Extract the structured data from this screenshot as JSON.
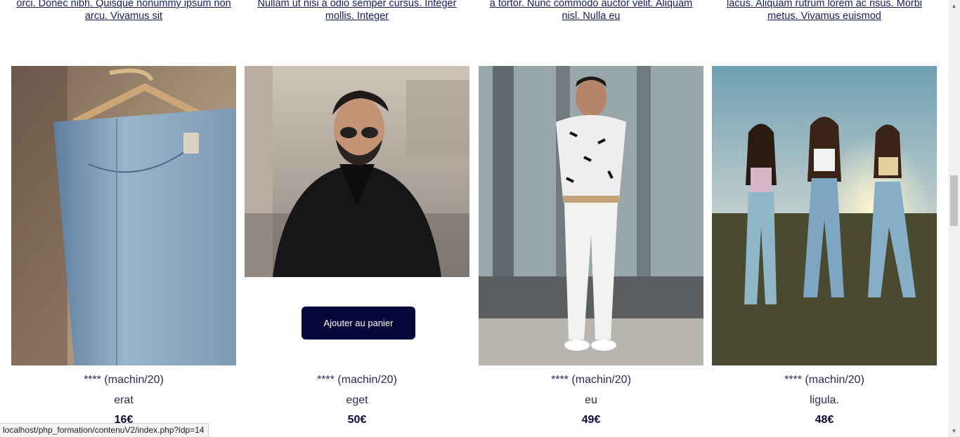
{
  "descriptions": [
    {
      "line1": "orci. Donec nibh. Quisque nonummy ipsum non",
      "line2": "arcu. Vivamus sit"
    },
    {
      "line1": "Nullam ut nisi a odio semper cursus. Integer",
      "line2": "mollis. Integer"
    },
    {
      "line1": "a tortor. Nunc commodo auctor velit. Aliquam",
      "line2": "nisl. Nulla eu"
    },
    {
      "line1": "lacus. Aliquam rutrum lorem ac risus. Morbi",
      "line2": "metus. Vivamus euismod"
    }
  ],
  "products": [
    {
      "rating": "**** (machin/20)",
      "name": "erat",
      "price": "16€",
      "image": "jeans-on-hanger"
    },
    {
      "rating": "**** (machin/20)",
      "name": "eget",
      "price": "50€",
      "image": "man-in-black-suit"
    },
    {
      "rating": "**** (machin/20)",
      "name": "eu",
      "price": "49€",
      "image": "man-white-pants"
    },
    {
      "rating": "**** (machin/20)",
      "name": "ligula.",
      "price": "48€",
      "image": "three-women-jeans"
    }
  ],
  "add_to_cart_label": "Ajouter au panier",
  "status_url": "localhost/php_formation/contenuV2/index.php?idp=14"
}
